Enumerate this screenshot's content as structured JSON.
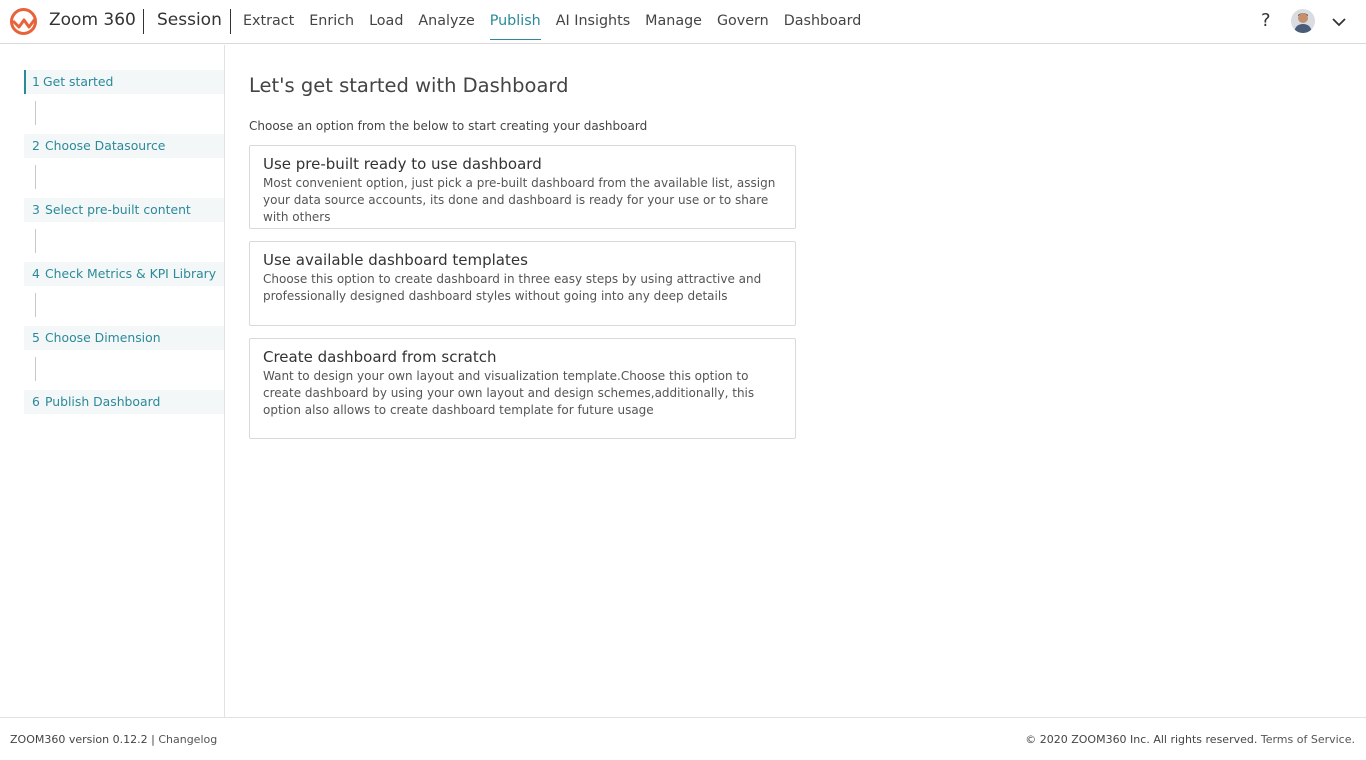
{
  "header": {
    "brand": "Zoom 360",
    "session": "Session",
    "nav": [
      "Extract",
      "Enrich",
      "Load",
      "Analyze",
      "Publish",
      "AI Insights",
      "Manage",
      "Govern",
      "Dashboard"
    ],
    "active_nav": "Publish",
    "help": "?",
    "icons": [
      "zoom360-logo-icon",
      "user-avatar",
      "chevron-down-icon"
    ],
    "accent_color": "#2a8a9a",
    "logo_color": "#e8623a"
  },
  "steps": [
    {
      "num": "1",
      "label": "Get started"
    },
    {
      "num": "2",
      "label": "Choose Datasource"
    },
    {
      "num": "3",
      "label": "Select pre-built content"
    },
    {
      "num": "4",
      "label": "Check Metrics & KPI Library"
    },
    {
      "num": "5",
      "label": "Choose Dimension"
    },
    {
      "num": "6",
      "label": "Publish Dashboard"
    }
  ],
  "main": {
    "title": "Let's get started with Dashboard",
    "subtitle": "Choose an option from the below to start creating your dashboard",
    "options": [
      {
        "title": "Use pre-built ready to use dashboard",
        "description": "Most convenient option, just pick a pre-built dashboard from the available list, assign your data source accounts, its done and dashboard is ready for your use or to share with others"
      },
      {
        "title": "Use available dashboard templates",
        "description": "Choose this option to create dashboard in three easy steps by using attractive and professionally designed dashboard styles without going into any deep details"
      },
      {
        "title": "Create dashboard from scratch",
        "description": "Want to design your own layout and visualization template.Choose this option to create dashboard by using your own layout and design schemes,additionally, this option also allows to create dashboard template for future usage"
      }
    ]
  },
  "footer": {
    "version": "ZOOM360 version 0.12.2",
    "divider": "|",
    "changelog": "Changelog",
    "copyright": "© 2020 ZOOM360 Inc. All rights reserved.",
    "terms": "Terms of Service."
  }
}
